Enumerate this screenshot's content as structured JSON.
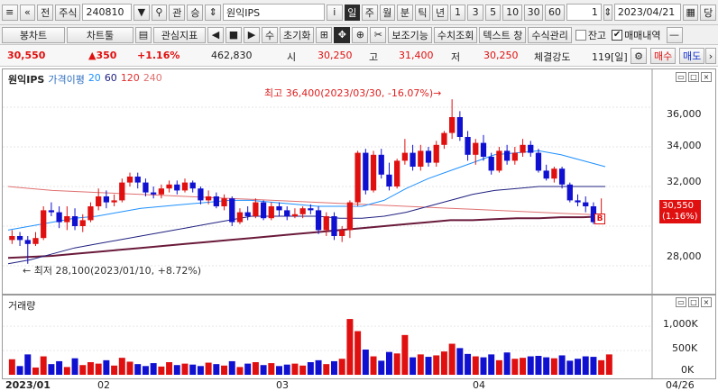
{
  "toolbar1": {
    "tab1": "전",
    "tab2": "주식",
    "code": "240810",
    "btn_gwan": "관",
    "btn_seung": "승",
    "name": "원익IPS",
    "info": "i",
    "periods": [
      "일",
      "주",
      "월",
      "분",
      "틱",
      "년"
    ],
    "active_period": "일",
    "intervals": [
      "1",
      "3",
      "5",
      "10",
      "30",
      "60"
    ],
    "count": "1",
    "date": "2023/04/21",
    "btn_dang": "당"
  },
  "toolbar2": {
    "chart_type": "봉차트",
    "chart_tools": "차트툴",
    "indicators": "관심지표",
    "btn_su": "수",
    "reset": "초기화",
    "aux": "보조기능",
    "value_query": "수치조회",
    "text_window": "텍스트 창",
    "formula": "수식관리",
    "balance": "잔고",
    "trade_history": "매매내역",
    "balance_checked": false,
    "trade_history_checked": true
  },
  "quote": {
    "price": "30,550",
    "change": "▲350",
    "change_pct": "+1.16%",
    "volume": "462,830",
    "open_label": "시",
    "open": "30,250",
    "high_label": "고",
    "high": "31,400",
    "low_label": "저",
    "low": "30,250",
    "strength_label": "체결강도",
    "strength": "119[일]",
    "buy": "매수",
    "sell": "매도"
  },
  "price_panel": {
    "title": "원익IPS",
    "legend_label": "가격이평",
    "ma": [
      "20",
      "60",
      "120",
      "240"
    ],
    "ma_colors": [
      "#1e90ff",
      "#202080",
      "#e03030",
      "#e07070"
    ],
    "high_note": "최고 36,400(2023/03/30, -16.07%)→",
    "low_note": "← 최저 28,100(2023/01/10, +8.72%)",
    "last_price": "30,550",
    "last_pct": "(1.16%)",
    "marker": "B",
    "y_ticks": [
      "36,000",
      "34,000",
      "32,000",
      "28,000"
    ]
  },
  "volume_panel": {
    "title": "거래량",
    "y_ticks": [
      "1,000K",
      "500K",
      "0K"
    ]
  },
  "x_axis": {
    "labels": [
      "2023/01",
      "02",
      "03",
      "04"
    ],
    "last": "04/26"
  },
  "chart_data": {
    "type": "candlestick",
    "ylim": [
      27000,
      37000
    ],
    "note": "daily candles 2023/01 – 2023/04",
    "candles": [
      {
        "o": 29300,
        "c": 29500,
        "h": 29800,
        "l": 29100
      },
      {
        "o": 29500,
        "c": 29300,
        "h": 29700,
        "l": 29000
      },
      {
        "o": 29300,
        "c": 29100,
        "h": 29500,
        "l": 28100
      },
      {
        "o": 29100,
        "c": 29400,
        "h": 29700,
        "l": 29000
      },
      {
        "o": 29400,
        "c": 30800,
        "h": 31000,
        "l": 29300
      },
      {
        "o": 30800,
        "c": 30700,
        "h": 31200,
        "l": 30500
      },
      {
        "o": 30700,
        "c": 30200,
        "h": 31000,
        "l": 29900
      },
      {
        "o": 30200,
        "c": 30500,
        "h": 31000,
        "l": 29800
      },
      {
        "o": 30500,
        "c": 30000,
        "h": 30900,
        "l": 29800
      },
      {
        "o": 30000,
        "c": 30300,
        "h": 30600,
        "l": 29700
      },
      {
        "o": 30300,
        "c": 31000,
        "h": 31200,
        "l": 30200
      },
      {
        "o": 31000,
        "c": 31500,
        "h": 31900,
        "l": 30800
      },
      {
        "o": 31500,
        "c": 31200,
        "h": 31800,
        "l": 30900
      },
      {
        "o": 31200,
        "c": 31300,
        "h": 31600,
        "l": 31000
      },
      {
        "o": 31300,
        "c": 32200,
        "h": 32400,
        "l": 31200
      },
      {
        "o": 32200,
        "c": 32500,
        "h": 32700,
        "l": 32000
      },
      {
        "o": 32500,
        "c": 32200,
        "h": 32700,
        "l": 31900
      },
      {
        "o": 32200,
        "c": 31700,
        "h": 32400,
        "l": 31500
      },
      {
        "o": 31700,
        "c": 31600,
        "h": 32000,
        "l": 31400
      },
      {
        "o": 31600,
        "c": 31900,
        "h": 32100,
        "l": 31400
      },
      {
        "o": 31900,
        "c": 32100,
        "h": 32300,
        "l": 31700
      },
      {
        "o": 32100,
        "c": 31800,
        "h": 32300,
        "l": 31600
      },
      {
        "o": 31800,
        "c": 32200,
        "h": 32400,
        "l": 31700
      },
      {
        "o": 32200,
        "c": 31900,
        "h": 32300,
        "l": 31700
      },
      {
        "o": 31900,
        "c": 31300,
        "h": 32000,
        "l": 31100
      },
      {
        "o": 31300,
        "c": 31500,
        "h": 31800,
        "l": 31100
      },
      {
        "o": 31500,
        "c": 31000,
        "h": 31700,
        "l": 30900
      },
      {
        "o": 31000,
        "c": 31400,
        "h": 31600,
        "l": 30800
      },
      {
        "o": 31400,
        "c": 30200,
        "h": 31500,
        "l": 30000
      },
      {
        "o": 30200,
        "c": 30700,
        "h": 30900,
        "l": 30100
      },
      {
        "o": 30700,
        "c": 30500,
        "h": 31000,
        "l": 30300
      },
      {
        "o": 30500,
        "c": 31200,
        "h": 31400,
        "l": 30400
      },
      {
        "o": 31200,
        "c": 30400,
        "h": 31300,
        "l": 30300
      },
      {
        "o": 30400,
        "c": 31000,
        "h": 31200,
        "l": 30300
      },
      {
        "o": 31000,
        "c": 30800,
        "h": 31200,
        "l": 30500
      },
      {
        "o": 30800,
        "c": 30500,
        "h": 31000,
        "l": 30300
      },
      {
        "o": 30500,
        "c": 30600,
        "h": 30900,
        "l": 30400
      },
      {
        "o": 30600,
        "c": 30900,
        "h": 31000,
        "l": 30400
      },
      {
        "o": 30900,
        "c": 30800,
        "h": 31100,
        "l": 30600
      },
      {
        "o": 30800,
        "c": 29800,
        "h": 31000,
        "l": 29600
      },
      {
        "o": 29800,
        "c": 30500,
        "h": 30700,
        "l": 29500
      },
      {
        "o": 30500,
        "c": 29500,
        "h": 30700,
        "l": 29300
      },
      {
        "o": 29500,
        "c": 29800,
        "h": 30000,
        "l": 29200
      },
      {
        "o": 29800,
        "c": 31200,
        "h": 31300,
        "l": 29400
      },
      {
        "o": 31200,
        "c": 33700,
        "h": 33800,
        "l": 31000
      },
      {
        "o": 33700,
        "c": 31800,
        "h": 33900,
        "l": 31600
      },
      {
        "o": 31800,
        "c": 33600,
        "h": 33800,
        "l": 31700
      },
      {
        "o": 33600,
        "c": 32600,
        "h": 33900,
        "l": 32400
      },
      {
        "o": 32600,
        "c": 32000,
        "h": 33200,
        "l": 31800
      },
      {
        "o": 32000,
        "c": 33300,
        "h": 33400,
        "l": 31900
      },
      {
        "o": 33300,
        "c": 33700,
        "h": 34400,
        "l": 33100
      },
      {
        "o": 33700,
        "c": 33000,
        "h": 34100,
        "l": 32800
      },
      {
        "o": 33000,
        "c": 33800,
        "h": 34100,
        "l": 32800
      },
      {
        "o": 33800,
        "c": 33200,
        "h": 34000,
        "l": 33000
      },
      {
        "o": 33200,
        "c": 34100,
        "h": 34300,
        "l": 33000
      },
      {
        "o": 34100,
        "c": 34700,
        "h": 34800,
        "l": 33900
      },
      {
        "o": 34700,
        "c": 35500,
        "h": 36400,
        "l": 34400
      },
      {
        "o": 35500,
        "c": 34500,
        "h": 35800,
        "l": 34300
      },
      {
        "o": 34500,
        "c": 33600,
        "h": 34800,
        "l": 33300
      },
      {
        "o": 33600,
        "c": 34200,
        "h": 34400,
        "l": 33100
      },
      {
        "o": 34200,
        "c": 33500,
        "h": 34600,
        "l": 33300
      },
      {
        "o": 33500,
        "c": 32800,
        "h": 33700,
        "l": 32600
      },
      {
        "o": 32800,
        "c": 33800,
        "h": 34000,
        "l": 32700
      },
      {
        "o": 33800,
        "c": 33300,
        "h": 34100,
        "l": 33100
      },
      {
        "o": 33300,
        "c": 33700,
        "h": 34000,
        "l": 33100
      },
      {
        "o": 33700,
        "c": 34100,
        "h": 34400,
        "l": 33500
      },
      {
        "o": 34100,
        "c": 33700,
        "h": 34300,
        "l": 33500
      },
      {
        "o": 33700,
        "c": 32800,
        "h": 33900,
        "l": 32700
      },
      {
        "o": 32800,
        "c": 32400,
        "h": 33100,
        "l": 32300
      },
      {
        "o": 32400,
        "c": 32900,
        "h": 33000,
        "l": 32200
      },
      {
        "o": 32900,
        "c": 32100,
        "h": 33000,
        "l": 31900
      },
      {
        "o": 32100,
        "c": 31300,
        "h": 32200,
        "l": 31200
      },
      {
        "o": 31300,
        "c": 31200,
        "h": 31600,
        "l": 31000
      },
      {
        "o": 31200,
        "c": 31000,
        "h": 31500,
        "l": 30700
      },
      {
        "o": 31000,
        "c": 30200,
        "h": 31200,
        "l": 30100
      },
      {
        "o": 30200,
        "c": 30550,
        "h": 31400,
        "l": 30250
      }
    ],
    "ma20": [
      29800,
      30000,
      30200,
      30400,
      30500,
      30700,
      30900,
      31000,
      31100,
      31200,
      31300,
      31300,
      31200,
      31100,
      31000,
      31000,
      31000,
      31300,
      31900,
      32400,
      32800,
      33200,
      33600,
      33700,
      33800,
      33600,
      33300,
      33000
    ],
    "ma60": [
      28100,
      28300,
      28600,
      28900,
      29100,
      29300,
      29500,
      29700,
      29900,
      30100,
      30300,
      30500,
      30500,
      30500,
      30500,
      30400,
      30400,
      30500,
      30700,
      31000,
      31300,
      31600,
      31800,
      31900,
      32000,
      32000,
      32000,
      32000
    ],
    "ma120": [
      28400,
      28450,
      28500,
      28600,
      28700,
      28800,
      28900,
      29000,
      29100,
      29200,
      29300,
      29400,
      29500,
      29600,
      29700,
      29800,
      29900,
      30000,
      30100,
      30200,
      30300,
      30300,
      30350,
      30400,
      30400,
      30450,
      30450,
      30500
    ],
    "ma240": [
      32000,
      31900,
      31800,
      31750,
      31700,
      31650,
      31600,
      31550,
      31500,
      31450,
      31400,
      31350,
      31300,
      31250,
      31200,
      31150,
      31100,
      31050,
      31000,
      30950,
      30900,
      30850,
      30800,
      30750,
      30700,
      30650,
      30600,
      30550
    ],
    "volume": [
      320,
      180,
      420,
      150,
      380,
      220,
      280,
      160,
      340,
      200,
      260,
      230,
      300,
      190,
      350,
      270,
      220,
      180,
      240,
      170,
      260,
      200,
      230,
      210,
      180,
      250,
      220,
      190,
      280,
      160,
      230,
      260,
      200,
      240,
      180,
      210,
      230,
      190,
      260,
      300,
      220,
      280,
      330,
      1150,
      900,
      520,
      380,
      290,
      470,
      440,
      820,
      360,
      420,
      370,
      400,
      480,
      640,
      550,
      430,
      380,
      360,
      420,
      300,
      460,
      330,
      350,
      380,
      390,
      360,
      340,
      400,
      290,
      330,
      380,
      370,
      300,
      420
    ]
  }
}
